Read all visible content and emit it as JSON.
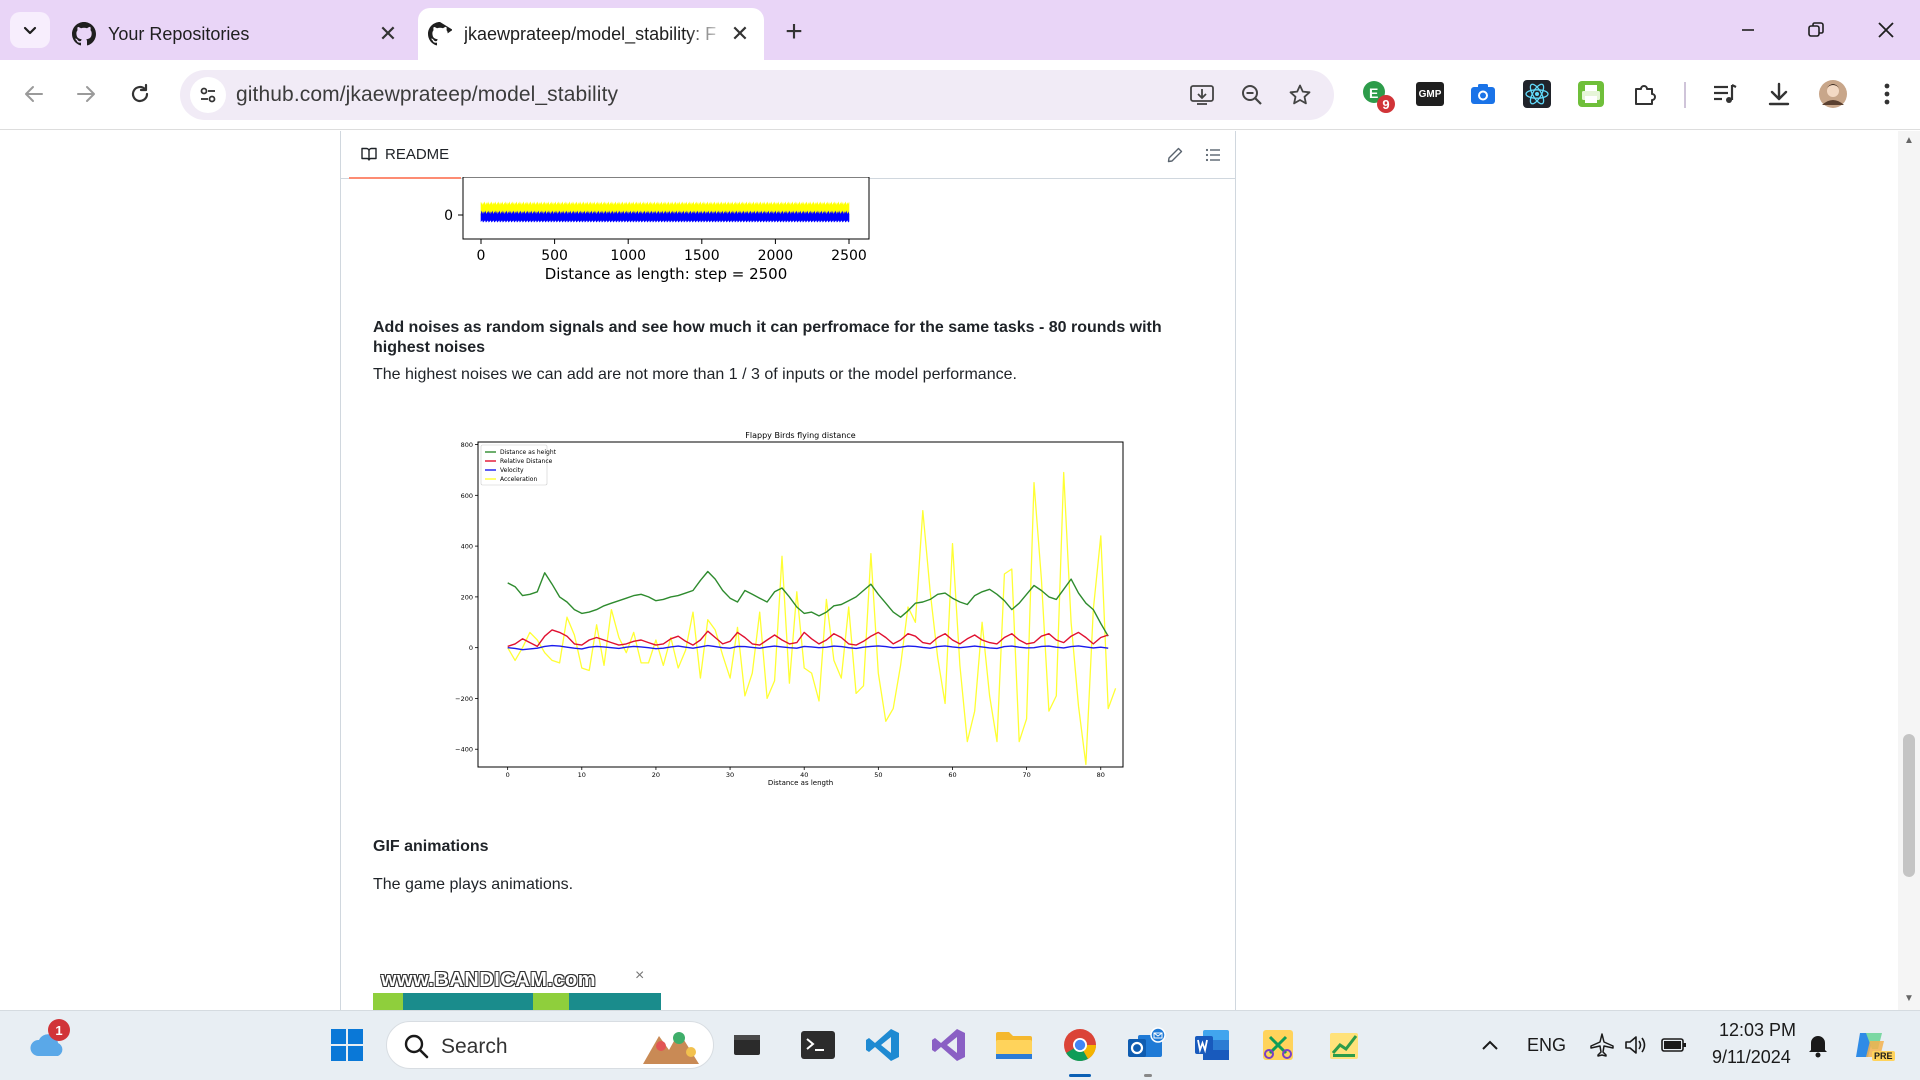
{
  "browser": {
    "tabs": [
      {
        "title": "Your Repositories",
        "active": false
      },
      {
        "title": "jkaewprateep/model_stability: F",
        "active": true
      }
    ],
    "new_tab_symbol": "+",
    "address": "github.com/jkaewprateep/model_stability",
    "extension_badge": "9",
    "extension_gmp_label": "GMP"
  },
  "readme": {
    "tab_label": "README",
    "paragraph_heading": "Add noises as random signals and see how much it can perfromace for the same tasks - 80 rounds with highest noises",
    "paragraph_body": "The highest noises we can add are not more than 1 / 3 of inputs or the model performance.",
    "gif_heading": "GIF animations",
    "gif_body": "The game plays animations.",
    "gif_watermark": "www.BANDICAM.com",
    "gif_close": "×"
  },
  "chart_data": [
    {
      "type": "area",
      "title": "",
      "xlabel": "Distance as length: step = 2500",
      "x_ticks": [
        "0",
        "500",
        "1000",
        "1500",
        "2000",
        "2500"
      ],
      "y_ticks_visible": [
        "0"
      ],
      "xlim": [
        0,
        2500
      ],
      "series": [
        {
          "color": "#ffff00",
          "band": [
            0.0,
            0.9
          ]
        },
        {
          "color": "#0000ff",
          "band": [
            -0.5,
            0.25
          ]
        }
      ]
    },
    {
      "type": "line",
      "title": "Flappy Birds flying distance",
      "xlabel": "Distance as length",
      "ylabel": "",
      "xlim": [
        -4,
        83
      ],
      "ylim": [
        -470,
        810
      ],
      "x_ticks": [
        0,
        10,
        20,
        30,
        40,
        50,
        60,
        70,
        80
      ],
      "y_ticks": [
        -400,
        -200,
        0,
        200,
        400,
        600,
        800
      ],
      "legend_position": "top-left",
      "series": [
        {
          "name": "Distance as height",
          "color": "#2e8b2e",
          "values": [
            255,
            240,
            205,
            210,
            220,
            295,
            250,
            200,
            180,
            150,
            135,
            140,
            150,
            165,
            175,
            185,
            195,
            205,
            210,
            200,
            185,
            190,
            200,
            205,
            215,
            225,
            265,
            300,
            270,
            225,
            195,
            180,
            225,
            210,
            195,
            180,
            220,
            235,
            200,
            160,
            135,
            140,
            125,
            140,
            165,
            170,
            185,
            200,
            225,
            250,
            210,
            175,
            140,
            120,
            145,
            175,
            180,
            190,
            210,
            215,
            195,
            180,
            170,
            205,
            220,
            230,
            210,
            185,
            150,
            175,
            210,
            245,
            225,
            200,
            190,
            230,
            270,
            215,
            175,
            150,
            95,
            45
          ]
        },
        {
          "name": "Relative Distance",
          "color": "#e01030",
          "values": [
            5,
            15,
            35,
            20,
            5,
            45,
            70,
            60,
            45,
            15,
            10,
            30,
            40,
            30,
            20,
            10,
            15,
            25,
            30,
            20,
            10,
            15,
            35,
            45,
            25,
            10,
            30,
            65,
            40,
            15,
            25,
            60,
            40,
            15,
            10,
            30,
            50,
            30,
            15,
            20,
            60,
            35,
            15,
            30,
            55,
            40,
            15,
            10,
            25,
            45,
            60,
            40,
            15,
            30,
            55,
            45,
            20,
            15,
            40,
            55,
            30,
            15,
            35,
            50,
            30,
            20,
            15,
            40,
            55,
            30,
            15,
            20,
            45,
            55,
            30,
            20,
            45,
            60,
            40,
            15,
            40,
            50
          ]
        },
        {
          "name": "Velocity",
          "color": "#1a1aee",
          "values": [
            0,
            -3,
            -8,
            -5,
            -2,
            5,
            8,
            6,
            2,
            -2,
            -5,
            2,
            5,
            3,
            0,
            -3,
            2,
            5,
            3,
            0,
            -4,
            -2,
            3,
            6,
            2,
            -2,
            3,
            8,
            4,
            0,
            -2,
            5,
            4,
            1,
            -2,
            3,
            6,
            3,
            0,
            -2,
            5,
            3,
            0,
            2,
            6,
            4,
            0,
            -3,
            2,
            5,
            7,
            4,
            0,
            2,
            6,
            5,
            1,
            -2,
            4,
            7,
            3,
            0,
            3,
            6,
            3,
            -1,
            -3,
            4,
            6,
            2,
            -1,
            0,
            5,
            6,
            2,
            -1,
            4,
            7,
            3,
            -1,
            2,
            -2
          ]
        },
        {
          "name": "Acceleration",
          "color": "#ffff33",
          "values": [
            0,
            -50,
            0,
            60,
            30,
            -20,
            -50,
            -60,
            120,
            50,
            -80,
            -90,
            90,
            -70,
            150,
            40,
            -20,
            60,
            -60,
            -60,
            30,
            -70,
            40,
            -80,
            -10,
            140,
            -120,
            110,
            70,
            -30,
            -120,
            80,
            -190,
            -100,
            140,
            -200,
            -130,
            360,
            -140,
            220,
            -80,
            -100,
            -210,
            190,
            -50,
            -120,
            160,
            -180,
            -150,
            370,
            -100,
            -290,
            -240,
            -70,
            160,
            100,
            540,
            220,
            -40,
            -220,
            410,
            -70,
            -370,
            -250,
            100,
            -190,
            -370,
            290,
            310,
            -370,
            -280,
            650,
            270,
            -250,
            -190,
            690,
            100,
            -230,
            -460,
            150,
            440,
            -240,
            -160
          ]
        }
      ]
    }
  ],
  "taskbar": {
    "search_label": "Search",
    "weather_badge": "1",
    "language": "ENG",
    "time": "12:03 PM",
    "date": "9/11/2024",
    "copilot_badge": "PRE"
  }
}
